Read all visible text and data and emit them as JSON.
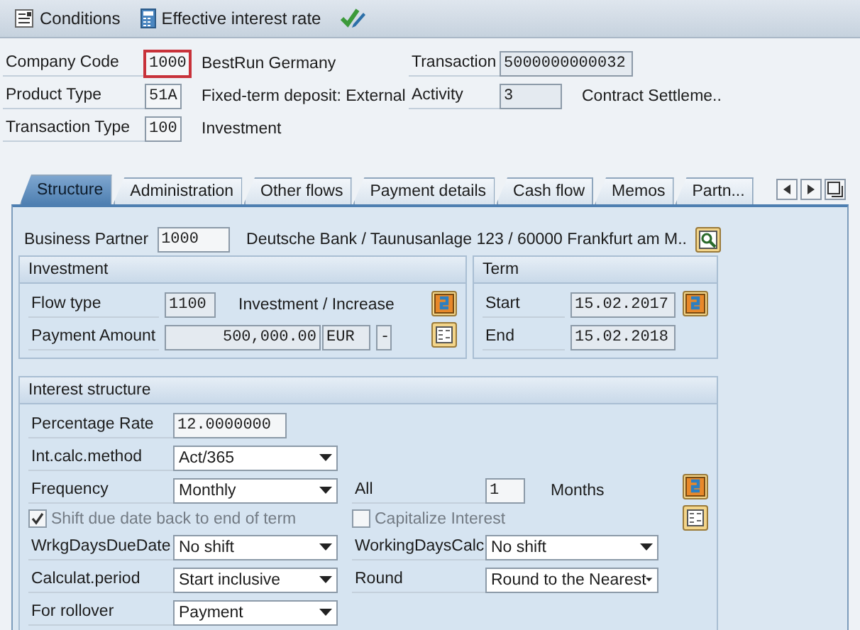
{
  "toolbar": [
    {
      "kind": "list",
      "label": "Conditions"
    },
    {
      "kind": "calculator",
      "label": "Effective interest rate"
    },
    {
      "kind": "check"
    }
  ],
  "header": {
    "left": [
      {
        "label": "Company Code",
        "value": "1000",
        "description": "BestRun Germany",
        "focused": true
      },
      {
        "label": "Product Type",
        "value": "51A",
        "description": "Fixed-term deposit: External",
        "focused": false
      },
      {
        "label": "Transaction Type",
        "value": "100",
        "description": "Investment",
        "focused": false
      }
    ],
    "right": [
      {
        "label": "Transaction",
        "value": "5000000000032"
      },
      {
        "label": "Activity",
        "value": "3",
        "description": "Contract Settleme.."
      }
    ]
  },
  "tabs": [
    {
      "label": "Structure",
      "selected": true
    },
    {
      "label": "Administration",
      "selected": false
    },
    {
      "label": "Other flows",
      "selected": false
    },
    {
      "label": "Payment details",
      "selected": false
    },
    {
      "label": "Cash flow",
      "selected": false
    },
    {
      "label": "Memos",
      "selected": false
    },
    {
      "label": "Partn...",
      "selected": false
    }
  ],
  "business_partner": {
    "label": "Business Partner",
    "value": "1000",
    "description": "Deutsche Bank / Taunusanlage 123 / 60000 Frankfurt am M.."
  },
  "investment": {
    "title": "Investment",
    "flow_type": {
      "label": "Flow type",
      "value": "1100",
      "description": "Investment / Increase"
    },
    "payment_amount": {
      "label": "Payment Amount",
      "value": "500,000.00",
      "currency": "EUR",
      "sign": "-"
    }
  },
  "term": {
    "title": "Term",
    "fields": [
      {
        "label": "Start",
        "value": "15.02.2017"
      },
      {
        "label": "End",
        "value": "15.02.2018"
      }
    ]
  },
  "interest": {
    "title": "Interest structure",
    "rows": [
      [
        {
          "kind": "input",
          "label": "Percentage Rate",
          "value": "12.0000000"
        }
      ],
      [
        {
          "kind": "select",
          "label": "Int.calc.method",
          "value": "Act/365"
        }
      ],
      [
        {
          "kind": "select",
          "label": "Frequency",
          "value": "Monthly"
        },
        {
          "kind": "input",
          "label": "All",
          "value": "1",
          "unit": "Months"
        }
      ],
      [
        {
          "kind": "checkbox",
          "label": "Shift due date back to end of term",
          "checked": true,
          "disabled": true
        },
        {
          "kind": "checkbox",
          "label": "Capitalize Interest",
          "checked": false,
          "disabled": true
        }
      ],
      [
        {
          "kind": "select",
          "label": "WrkgDaysDueDate",
          "value": "No shift"
        },
        {
          "kind": "select",
          "label": "WorkingDaysCalc",
          "value": "No shift"
        }
      ],
      [
        {
          "kind": "select",
          "label": "Calculat.period",
          "value": "Start inclusive"
        },
        {
          "kind": "select",
          "label": "Round",
          "value": "Round to the Nearest"
        }
      ],
      [
        {
          "kind": "select",
          "label": "For rollover",
          "value": "Payment"
        }
      ]
    ]
  }
}
